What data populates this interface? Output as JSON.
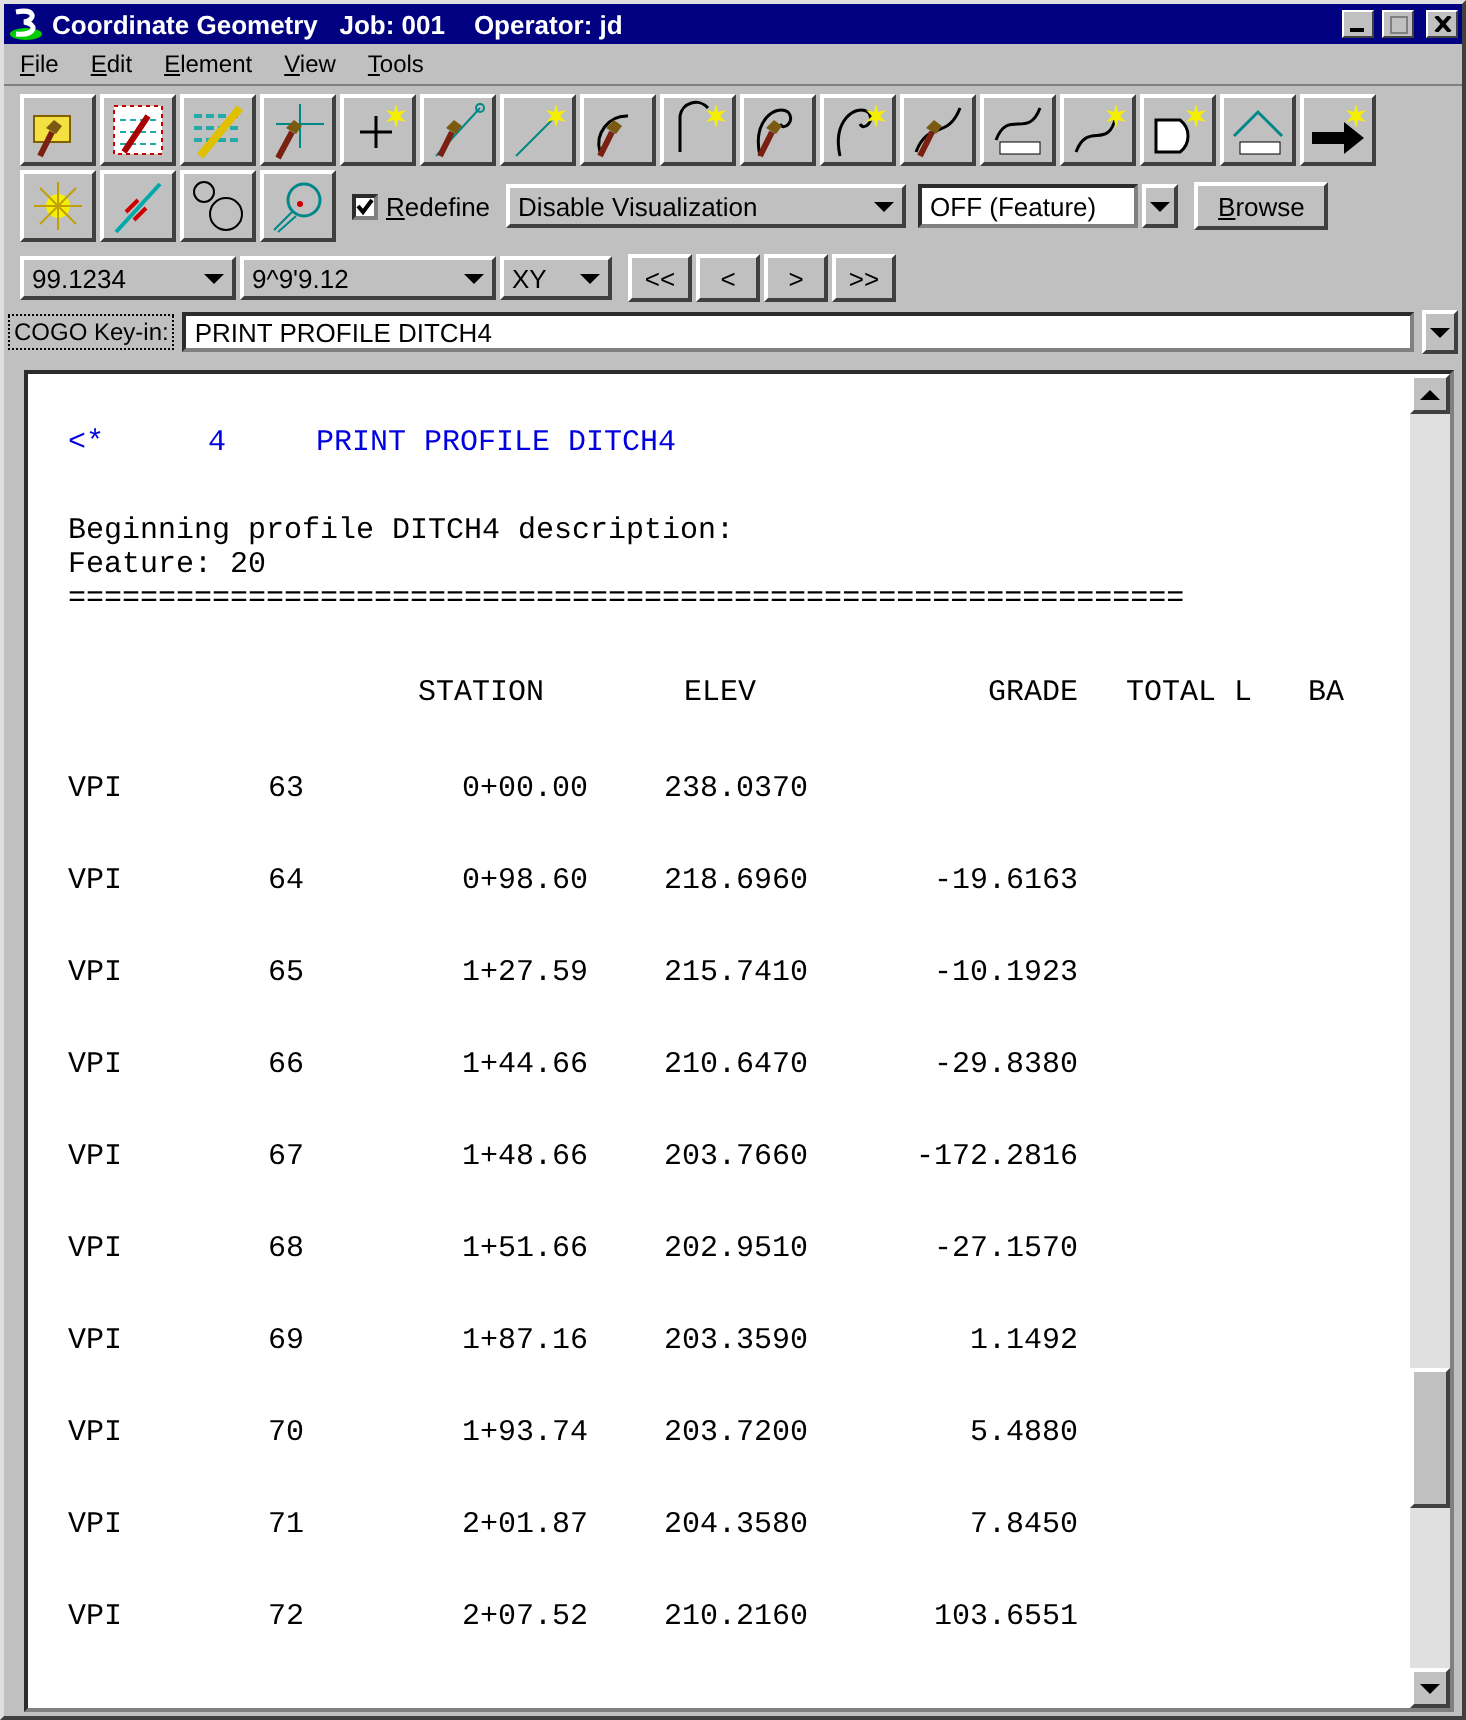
{
  "window": {
    "title": "Coordinate Geometry   Job: 001    Operator: jd"
  },
  "menu": [
    "File",
    "Edit",
    "Element",
    "View",
    "Tools"
  ],
  "options": {
    "redefine": {
      "label": "Redefine",
      "checked": true
    },
    "visualization": "Disable Visualization",
    "feature_mode": "OFF (Feature)",
    "browse": "Browse"
  },
  "format_bar": {
    "distance": "99.1234",
    "angle": "9^9'9.12",
    "plane": "XY",
    "nav": [
      "<<",
      "<",
      ">",
      ">>"
    ]
  },
  "keyin": {
    "label": "COGO Key-in:",
    "value": "PRINT PROFILE DITCH4"
  },
  "output": {
    "command": {
      "marker": "<*",
      "number": "4",
      "text": "PRINT PROFILE DITCH4"
    },
    "lines": [
      "Beginning profile DITCH4 description:",
      "Feature: 20"
    ],
    "rule": "==============================================================",
    "columns": [
      "STATION",
      "ELEV",
      "GRADE",
      "TOTAL L",
      "BA"
    ],
    "rows": [
      {
        "type": "VPI",
        "point": "63",
        "station": "0+00.00",
        "elev": "238.0370",
        "grade": ""
      },
      {
        "type": "VPI",
        "point": "64",
        "station": "0+98.60",
        "elev": "218.6960",
        "grade": "-19.6163"
      },
      {
        "type": "VPI",
        "point": "65",
        "station": "1+27.59",
        "elev": "215.7410",
        "grade": "-10.1923"
      },
      {
        "type": "VPI",
        "point": "66",
        "station": "1+44.66",
        "elev": "210.6470",
        "grade": "-29.8380"
      },
      {
        "type": "VPI",
        "point": "67",
        "station": "1+48.66",
        "elev": "203.7660",
        "grade": "-172.2816"
      },
      {
        "type": "VPI",
        "point": "68",
        "station": "1+51.66",
        "elev": "202.9510",
        "grade": "-27.1570"
      },
      {
        "type": "VPI",
        "point": "69",
        "station": "1+87.16",
        "elev": "203.3590",
        "grade": "1.1492"
      },
      {
        "type": "VPI",
        "point": "70",
        "station": "1+93.74",
        "elev": "203.7200",
        "grade": "5.4880"
      },
      {
        "type": "VPI",
        "point": "71",
        "station": "2+01.87",
        "elev": "204.3580",
        "grade": "7.8450"
      },
      {
        "type": "VPI",
        "point": "72",
        "station": "2+07.52",
        "elev": "210.2160",
        "grade": "103.6551"
      }
    ]
  }
}
